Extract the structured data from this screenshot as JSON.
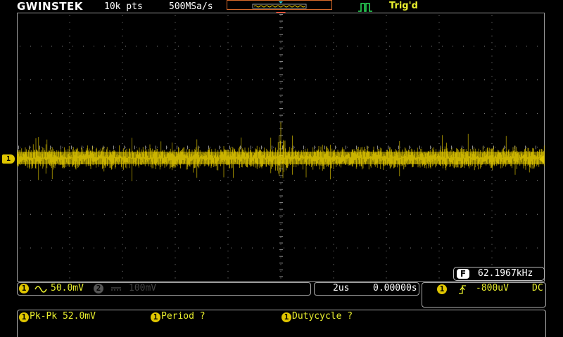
{
  "header": {
    "brand": "GWINSTEK",
    "memory_depth": "10k pts",
    "sample_rate": "500MSa/s",
    "trigger_status": "Trig'd"
  },
  "colors": {
    "channel1": "#e0c600",
    "trigger_marker": "#ff3b1a",
    "grid": "#9a9a9a",
    "overview_border": "#d86a2a"
  },
  "channel_marker": {
    "label": "1"
  },
  "frequency_counter": {
    "icon_label": "F",
    "value": "62.1967kHz"
  },
  "channels": {
    "ch1": {
      "number": "1",
      "coupling_icon": "ac-coupling-icon",
      "scale": "50.0mV"
    },
    "ch2": {
      "number": "2",
      "coupling_icon": "dc-coupling-icon",
      "scale": "100mV"
    }
  },
  "timebase": {
    "scale": "2us",
    "position": "0.00000s"
  },
  "trigger": {
    "source": "1",
    "slope_icon": "rising-edge-icon",
    "level": "-800uV",
    "coupling": "DC"
  },
  "measurements": [
    {
      "source": "1",
      "label": "Pk-Pk 52.0mV"
    },
    {
      "source": "1",
      "label": "Period ?"
    },
    {
      "source": "1",
      "label": "Dutycycle ?"
    }
  ]
}
